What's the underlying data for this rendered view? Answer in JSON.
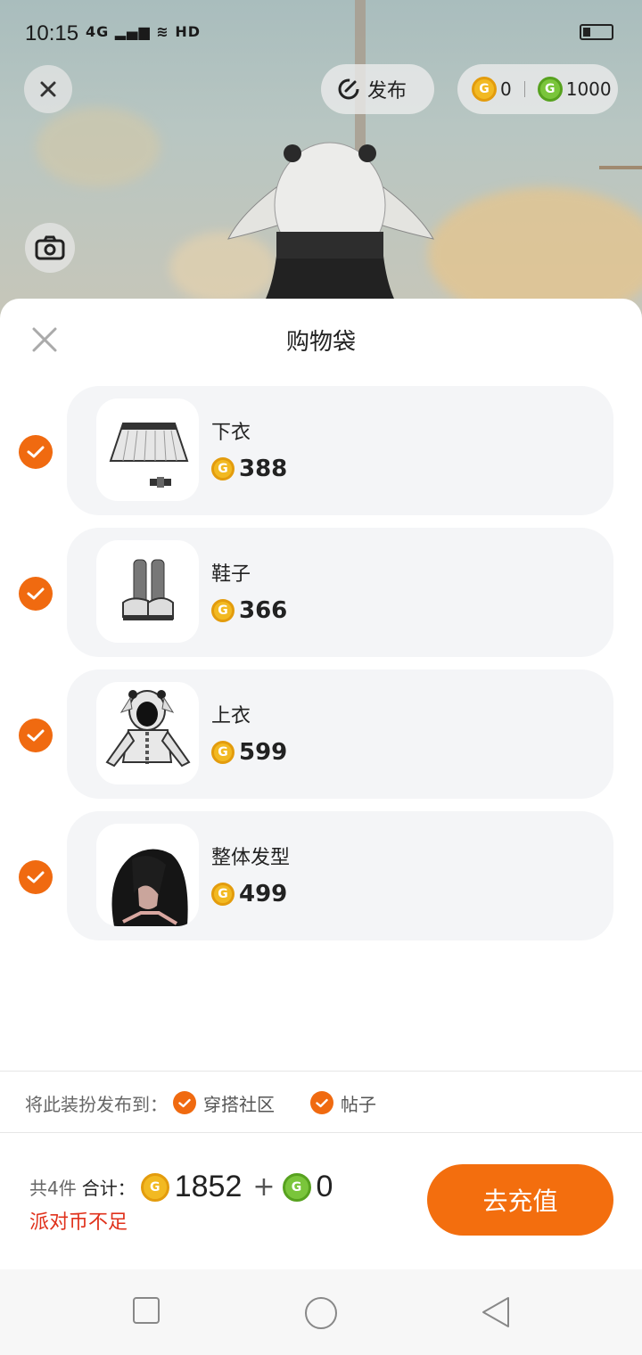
{
  "status_bar": {
    "time": "10:15",
    "network": "4G",
    "hd": "HD"
  },
  "top_bar": {
    "publish_label": "发布",
    "gold_balance": "0",
    "green_balance": "1000"
  },
  "sheet": {
    "title": "购物袋",
    "items": [
      {
        "name": "下衣",
        "price": "388",
        "checked": true
      },
      {
        "name": "鞋子",
        "price": "366",
        "checked": true
      },
      {
        "name": "上衣",
        "price": "599",
        "checked": true
      },
      {
        "name": "整体发型",
        "price": "499",
        "checked": true
      }
    ],
    "publish_to_label": "将此装扮发布到：",
    "publish_options": [
      {
        "label": "穿搭社区",
        "checked": true
      },
      {
        "label": "帖子",
        "checked": true
      }
    ]
  },
  "footer": {
    "count_text": "共4件",
    "total_label": "合计：",
    "gold_total": "1852",
    "plus": "+",
    "green_total": "0",
    "warning": "派对币不足",
    "recharge_label": "去充值"
  },
  "colors": {
    "accent": "#f36e0e",
    "warning": "#e0311b",
    "gold_coin": "#f2b922",
    "green_coin": "#7ac53b"
  },
  "icons": [
    "close-icon",
    "publish-icon",
    "camera-icon",
    "check-icon",
    "gold-coin-icon",
    "green-coin-icon",
    "nav-square-icon",
    "nav-circle-icon",
    "nav-back-icon"
  ]
}
